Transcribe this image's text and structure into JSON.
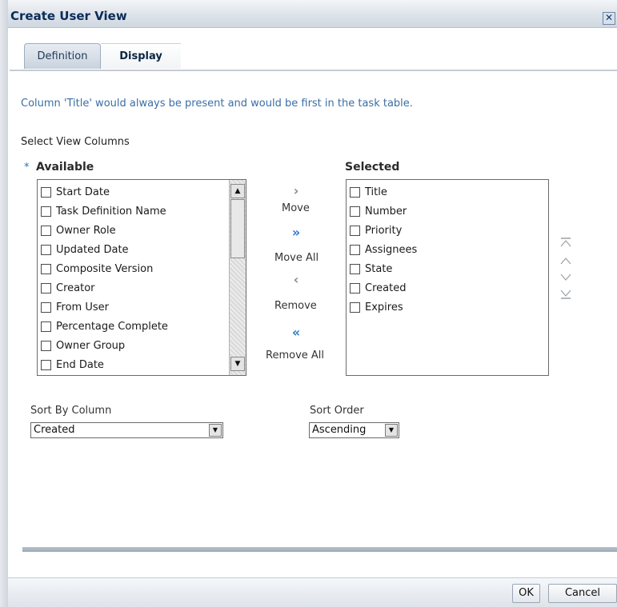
{
  "window": {
    "title": "Create User View",
    "close_icon": "close-icon"
  },
  "tabs": [
    {
      "label": "Definition",
      "active": false
    },
    {
      "label": "Display",
      "active": true
    }
  ],
  "info_text": "Column 'Title' would always be present and would be first in the task table.",
  "select_view_columns_label": "Select View Columns",
  "available": {
    "required_marker": "*",
    "label": "Available",
    "items": [
      "Start Date",
      "Task Definition Name",
      "Owner Role",
      "Updated Date",
      "Composite Version",
      "Creator",
      "From User",
      "Percentage Complete",
      "Owner Group",
      "End Date"
    ]
  },
  "selected": {
    "label": "Selected",
    "items": [
      "Title",
      "Number",
      "Priority",
      "Assignees",
      "State",
      "Created",
      "Expires"
    ]
  },
  "shuttle": {
    "move_label": "Move",
    "move_all_label": "Move All",
    "remove_label": "Remove",
    "remove_all_label": "Remove All"
  },
  "sort": {
    "column_label": "Sort By Column",
    "column_value": "Created",
    "order_label": "Sort Order",
    "order_value": "Ascending"
  },
  "footer": {
    "ok_label": "OK",
    "cancel_label": "Cancel"
  },
  "colors": {
    "info_text": "#3a6ea5",
    "title_text": "#0b2c58",
    "shuttle_active": "#2a78c8"
  }
}
